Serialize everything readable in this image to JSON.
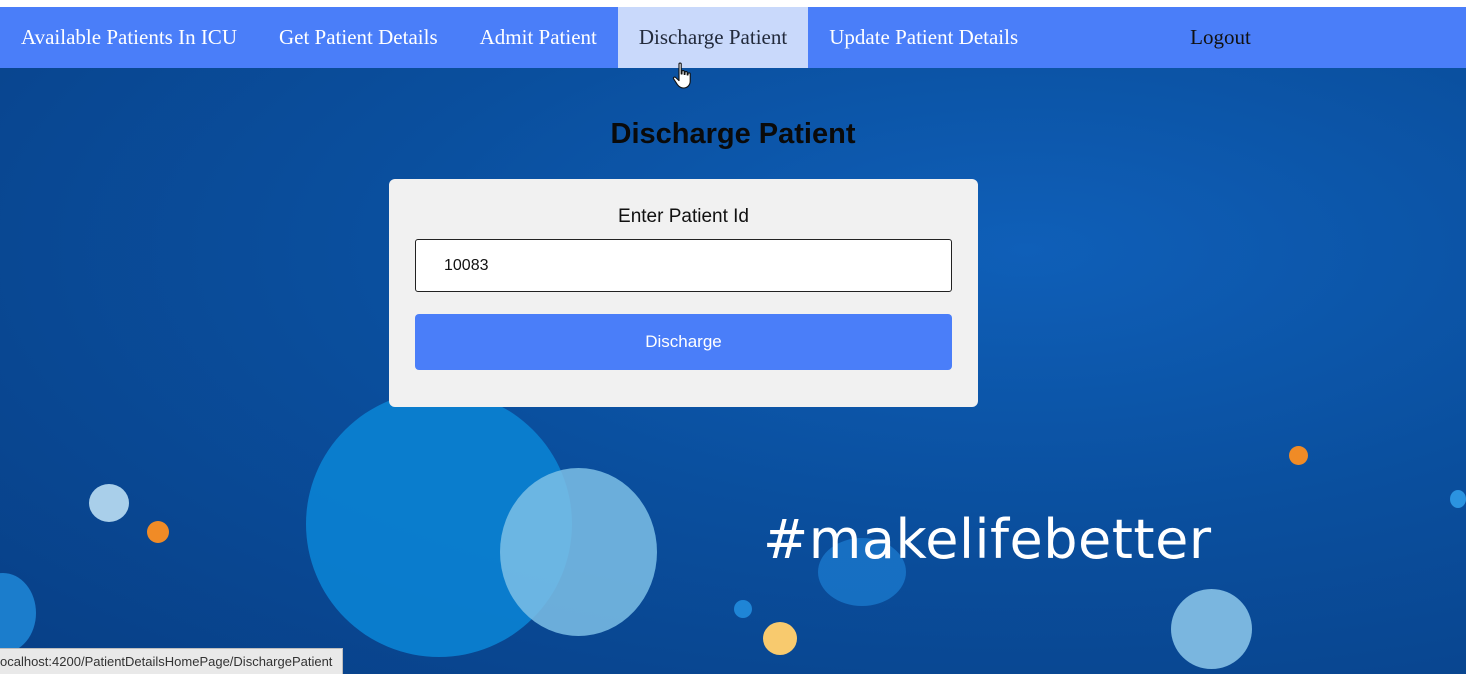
{
  "nav": {
    "items": [
      {
        "label": "Available Patients In ICU"
      },
      {
        "label": "Get Patient Details"
      },
      {
        "label": "Admit Patient"
      },
      {
        "label": "Discharge Patient"
      },
      {
        "label": "Update Patient Details"
      }
    ],
    "logout_label": "Logout",
    "active_item": "Discharge Patient"
  },
  "page": {
    "title": "Discharge Patient"
  },
  "form": {
    "label": "Enter Patient Id",
    "patient_id_value": "10083",
    "submit_label": "Discharge"
  },
  "hero": {
    "tagline": "#makelifebetter"
  },
  "status_bar": {
    "url": "ocalhost:4200/PatientDetailsHomePage/DischargePatient"
  },
  "colors": {
    "accent": "#4a7ef9",
    "nav_active": "#c9d9fb",
    "hero_background": "#0a4f9e",
    "card_background": "#f1f1f1"
  }
}
